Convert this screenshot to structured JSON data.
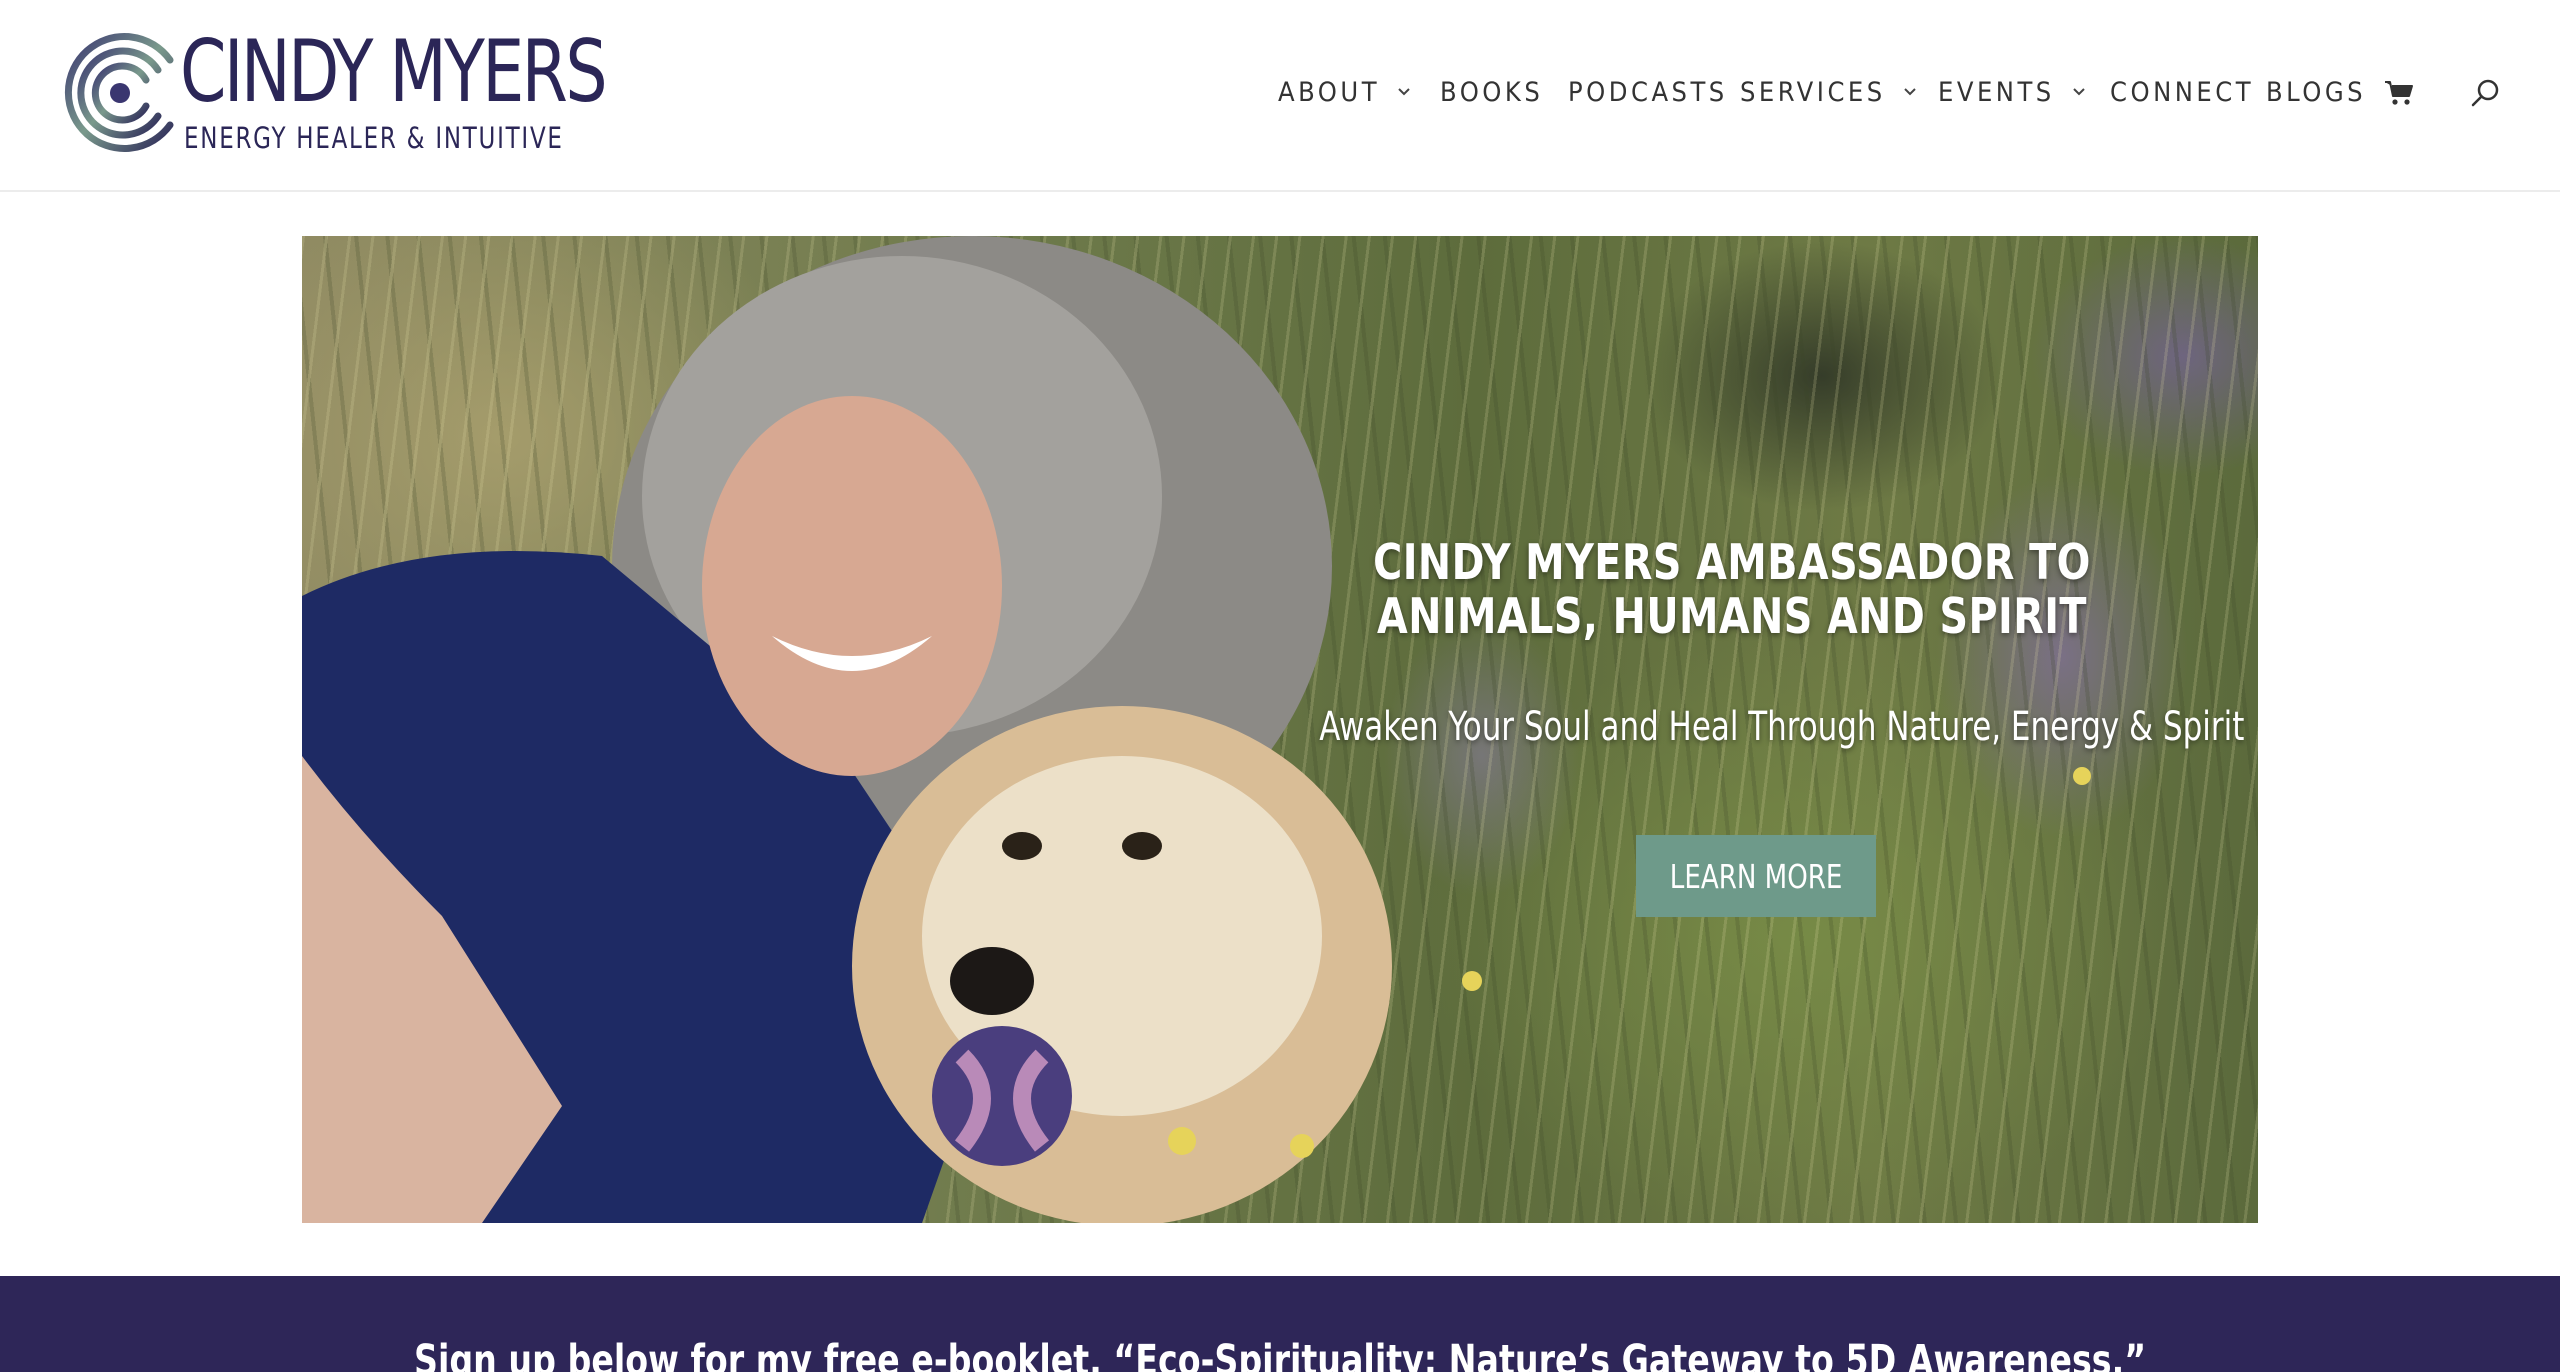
{
  "colors": {
    "brand_purple": "#2b2657",
    "band_purple": "#2e2658",
    "button_teal": "#6e9a8a",
    "nav_text": "#333333"
  },
  "logo": {
    "name": "CINDY MYERS",
    "tagline": "ENERGY HEALER & INTUITIVE",
    "icon": "concentric-c-logo"
  },
  "nav": {
    "items": [
      {
        "label": "ABOUT",
        "has_dropdown": true
      },
      {
        "label": "BOOKS",
        "has_dropdown": false
      },
      {
        "label": "PODCASTS",
        "has_dropdown": false
      },
      {
        "label": "SERVICES",
        "has_dropdown": true
      },
      {
        "label": "EVENTS",
        "has_dropdown": true
      },
      {
        "label": "CONNECT",
        "has_dropdown": false
      },
      {
        "label": "BLOGS",
        "has_dropdown": false
      }
    ],
    "cart_icon": "cart-icon",
    "search_icon": "search-icon"
  },
  "hero": {
    "title": "CINDY MYERS AMBASSADOR TO ANIMALS, HUMANS AND SPIRIT",
    "subtitle": "Awaken Your Soul and Heal Through Nature, Energy & Spirit",
    "button_label": "LEARN MORE"
  },
  "signup": {
    "text": "Sign up below for my free e-booklet, “Eco-Spirituality: Nature’s Gateway to 5D Awareness.”"
  }
}
